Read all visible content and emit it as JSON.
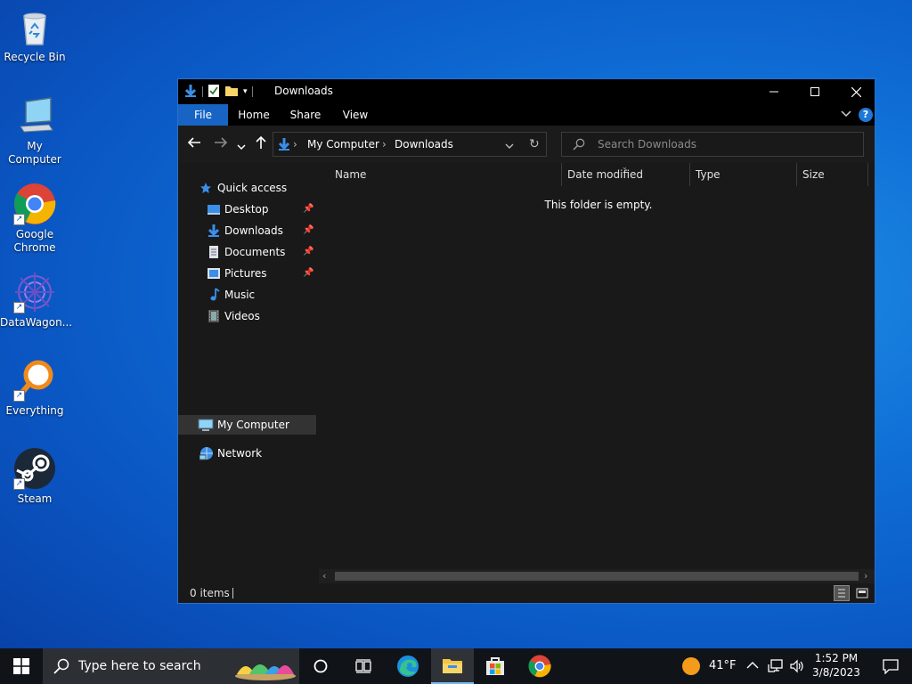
{
  "desktop": {
    "icons": [
      {
        "label": "Recycle Bin"
      },
      {
        "label": "My Computer"
      },
      {
        "label": "Google\nChrome"
      },
      {
        "label": "DataWagon..."
      },
      {
        "label": "Everything"
      },
      {
        "label": "Steam"
      }
    ]
  },
  "window": {
    "title": "Downloads",
    "ribbon_tabs": [
      "File",
      "Home",
      "Share",
      "View"
    ],
    "address": {
      "segments": [
        "My Computer",
        "Downloads"
      ]
    },
    "search_placeholder": "Search Downloads",
    "nav": {
      "quick_access": "Quick access",
      "items": [
        {
          "label": "Desktop",
          "pinned": true
        },
        {
          "label": "Downloads",
          "pinned": true
        },
        {
          "label": "Documents",
          "pinned": true
        },
        {
          "label": "Pictures",
          "pinned": true
        },
        {
          "label": "Music",
          "pinned": false
        },
        {
          "label": "Videos",
          "pinned": false
        }
      ],
      "my_computer": "My Computer",
      "network": "Network"
    },
    "columns": [
      "Name",
      "Date modified",
      "Type",
      "Size"
    ],
    "empty_message": "This folder is empty.",
    "status": "0 items"
  },
  "taskbar": {
    "search_placeholder": "Type here to search",
    "weather": "41°F",
    "time": "1:52 PM",
    "date": "3/8/2023"
  },
  "colors": {
    "accent": "#1764c4",
    "window_bg": "#191919",
    "titlebar": "#000000"
  }
}
